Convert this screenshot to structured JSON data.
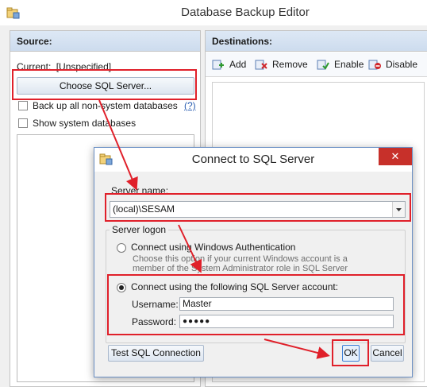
{
  "main_window": {
    "title": "Database Backup Editor",
    "source": {
      "header": "Source:",
      "current_label": "Current:",
      "current_value": "[Unspecified]",
      "choose_button": "Choose SQL Server...",
      "backup_all_label": "Back up all non-system databases",
      "help_marker": "(?)",
      "show_system_label": "Show system databases"
    },
    "destinations": {
      "header": "Destinations:",
      "toolbar": {
        "add": "Add",
        "remove": "Remove",
        "enable": "Enable",
        "disable": "Disable"
      }
    }
  },
  "dialog": {
    "title": "Connect to SQL Server",
    "close_glyph": "✕",
    "server_name_label": "Server name:",
    "server_name_value": "(local)\\SESAM",
    "server_logon_group": "Server logon",
    "windows_auth": {
      "label": "Connect using Windows Authentication",
      "description_line1": "Choose this option if your current Windows account is a",
      "description_line2": "member of the System Administrator role in SQL Server",
      "selected": false
    },
    "sql_auth": {
      "label": "Connect using the following SQL Server account:",
      "selected": true,
      "username_label": "Username:",
      "username_value": "Master",
      "password_label": "Password:",
      "password_value": "●●●●●"
    },
    "test_button": "Test SQL Connection",
    "ok_button": "OK",
    "cancel_button": "Cancel"
  },
  "colors": {
    "annotation_red": "#e0202a",
    "panel_header": "#d6e3f3"
  }
}
